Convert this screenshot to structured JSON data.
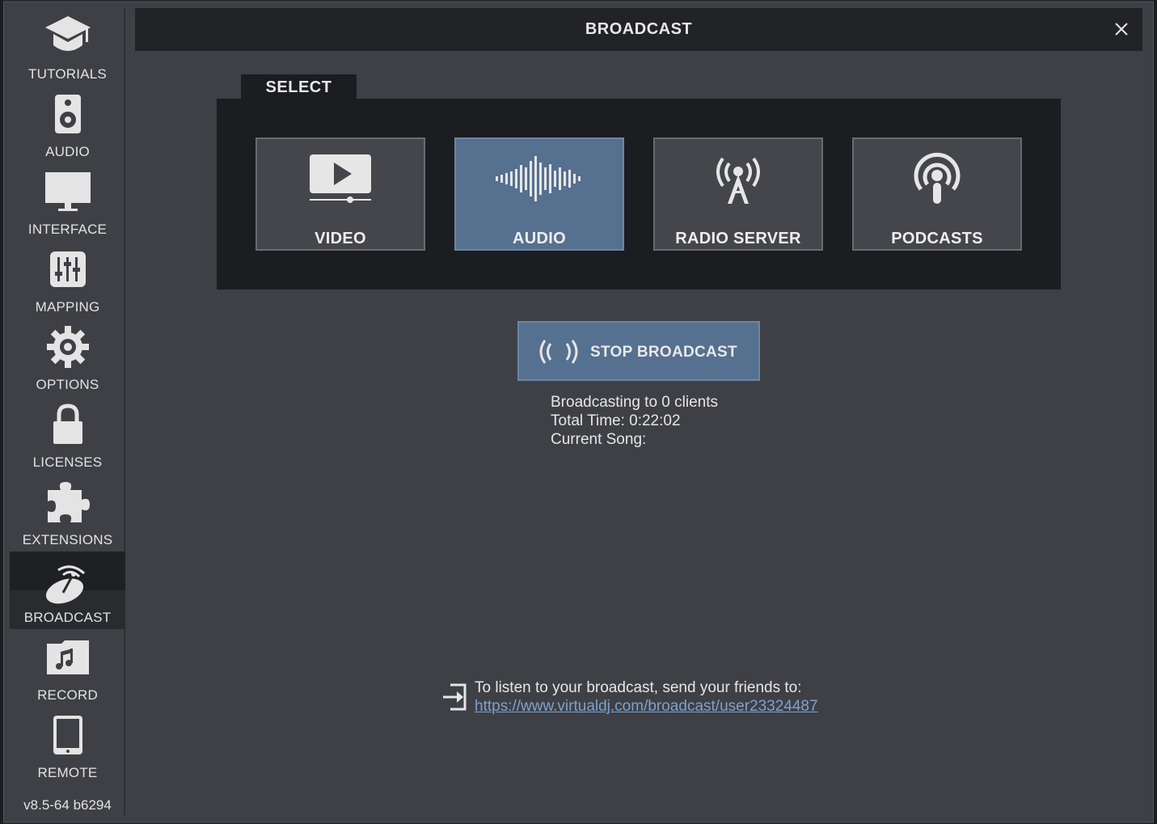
{
  "sidebar": {
    "items": [
      {
        "label": "TUTORIALS",
        "icon": "graduation-cap-icon"
      },
      {
        "label": "AUDIO",
        "icon": "speaker-icon"
      },
      {
        "label": "INTERFACE",
        "icon": "monitor-icon"
      },
      {
        "label": "MAPPING",
        "icon": "sliders-icon"
      },
      {
        "label": "OPTIONS",
        "icon": "gear-icon"
      },
      {
        "label": "LICENSES",
        "icon": "lock-icon"
      },
      {
        "label": "EXTENSIONS",
        "icon": "puzzle-icon"
      },
      {
        "label": "BROADCAST",
        "icon": "satellite-dish-icon",
        "active": true
      },
      {
        "label": "RECORD",
        "icon": "music-folder-icon"
      },
      {
        "label": "REMOTE",
        "icon": "tablet-icon"
      }
    ],
    "version": "v8.5-64 b6294"
  },
  "header": {
    "title": "BROADCAST",
    "close_icon": "close-icon"
  },
  "select": {
    "tab_label": "SELECT",
    "modes": [
      {
        "label": "VIDEO",
        "icon": "video-play-icon",
        "active": false
      },
      {
        "label": "AUDIO",
        "icon": "audio-wave-icon",
        "active": true
      },
      {
        "label": "RADIO SERVER",
        "icon": "radio-tower-icon",
        "active": false
      },
      {
        "label": "PODCASTS",
        "icon": "podcast-icon",
        "active": false
      }
    ]
  },
  "broadcast": {
    "stop_label": "STOP BROADCAST",
    "stop_icon": "broadcast-waves-icon",
    "status": {
      "clients": "Broadcasting to 0 clients",
      "total_time": "Total Time: 0:22:02",
      "current_song": "Current Song:"
    }
  },
  "share": {
    "text": "To listen to your broadcast, send your friends to:",
    "link": "https://www.virtualdj.com/broadcast/user23324487",
    "icon": "share-arrow-icon"
  },
  "colors": {
    "accent": "#56708f",
    "link": "#7aa2cf",
    "background": "#3f4045",
    "panel": "#1c1d20"
  }
}
